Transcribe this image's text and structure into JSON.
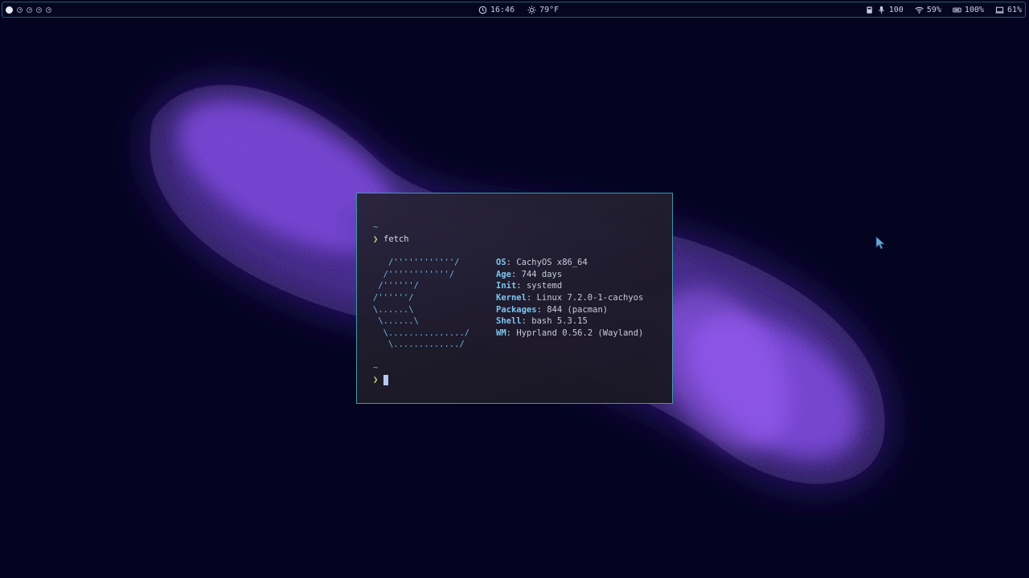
{
  "topbar": {
    "workspaces": [
      {
        "id": 1,
        "active": true
      },
      {
        "id": 2,
        "active": false
      },
      {
        "id": 3,
        "active": false
      },
      {
        "id": 4,
        "active": false
      },
      {
        "id": 5,
        "active": false
      }
    ],
    "clock": {
      "icon": "clock-icon",
      "time": "16:46"
    },
    "weather": {
      "icon": "sun-icon",
      "temperature": "79°F"
    },
    "microphone": {
      "icon": "microphone-icon",
      "volume": "100"
    },
    "wifi": {
      "icon": "wifi-icon",
      "strength": "59%"
    },
    "memory": {
      "icon": "memory-icon",
      "usage": "100%"
    },
    "battery": {
      "icon": "laptop-battery-icon",
      "level": "61%"
    }
  },
  "terminal": {
    "prompt_dir": "~",
    "prompt_symbol": "❯",
    "command": "fetch",
    "logo_lines": [
      "   /''''''''''''/",
      "  /''''''''''''/",
      " /''''''/",
      "/''''''/",
      "\\......\\",
      " \\......\\",
      "  \\.............../",
      "   \\............./"
    ],
    "info": [
      {
        "key": "OS",
        "value": "CachyOS x86_64"
      },
      {
        "key": "Age",
        "value": "744 days"
      },
      {
        "key": "Init",
        "value": "systemd"
      },
      {
        "key": "Kernel",
        "value": "Linux 7.2.0-1-cachyos"
      },
      {
        "key": "Packages",
        "value": "844 (pacman)"
      },
      {
        "key": "Shell",
        "value": "bash 5.3.15"
      },
      {
        "key": "WM",
        "value": "Hyprland 0.56.2 (Wayland)"
      }
    ],
    "separator": ": "
  },
  "colors": {
    "background": "#040420",
    "accent": "#3b9aa8",
    "nebula": "#8a4dff"
  }
}
